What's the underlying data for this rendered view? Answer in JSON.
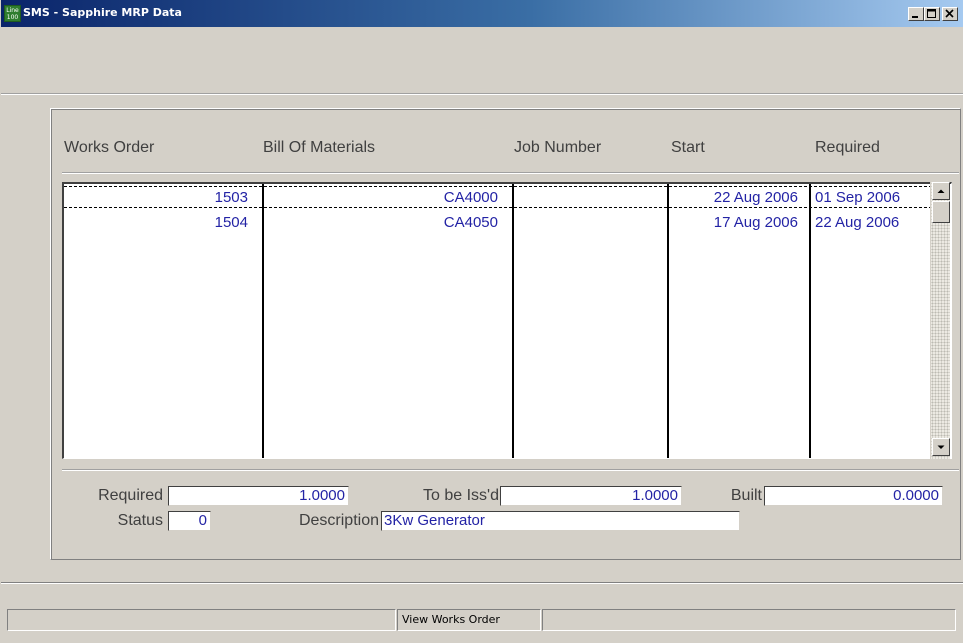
{
  "window": {
    "title": "SMS - Sapphire MRP Data",
    "icon_text": "Line 100"
  },
  "columns": [
    "Works Order",
    "Bill Of Materials",
    "Job Number",
    "Start",
    "Required"
  ],
  "rows": [
    {
      "works_order": "1503",
      "bill_of_materials": "CA4000",
      "job_number": "",
      "start": "22 Aug 2006",
      "required": "01 Sep 2006"
    },
    {
      "works_order": "1504",
      "bill_of_materials": "CA4050",
      "job_number": "",
      "start": "17 Aug 2006",
      "required": "22 Aug 2006"
    }
  ],
  "details": {
    "required_label": "Required",
    "required_value": "1.0000",
    "to_be_issued_label": "To be Iss'd",
    "to_be_issued_value": "1.0000",
    "built_label": "Built",
    "built_value": "0.0000",
    "status_label": "Status",
    "status_value": "0",
    "description_label": "Description",
    "description_value": "3Kw Generator"
  },
  "statusbar": {
    "pane1": "",
    "pane2": "View Works Order",
    "pane3": ""
  },
  "colors": {
    "value_text": "#2323a5",
    "window_bg": "#d4d0c8",
    "title_bar": "#0a246a"
  },
  "icons": {
    "app": "mrp-app-icon",
    "minimize": "minimize-icon",
    "maximize": "maximize-icon",
    "close": "close-icon",
    "scroll_up": "scroll-up-arrow-icon",
    "scroll_down": "scroll-down-arrow-icon"
  }
}
